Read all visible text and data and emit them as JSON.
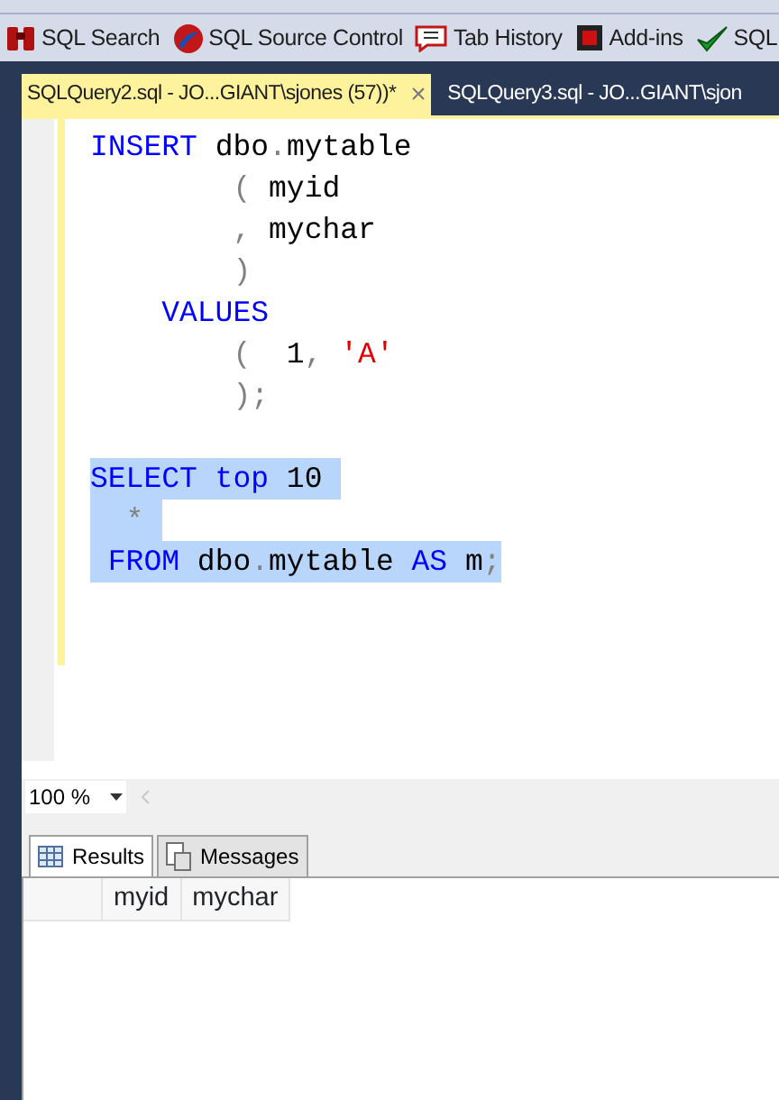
{
  "toolbar": [
    {
      "label": "SQL Search"
    },
    {
      "label": "SQL Source Control"
    },
    {
      "label": "Tab History"
    },
    {
      "label": "Add-ins"
    },
    {
      "label": "SQL"
    }
  ],
  "document_tabs": [
    {
      "label": "SQLQuery2.sql - JO...GIANT\\sjones (57))*",
      "selected": true,
      "close": "×"
    },
    {
      "label": "SQLQuery3.sql - JO...GIANT\\sjon",
      "selected": false
    }
  ],
  "editor": {
    "lines": [
      {
        "selected": false,
        "tokens": [
          {
            "kind": "keyword",
            "text": "INSERT"
          },
          {
            "kind": "plain",
            "text": " dbo"
          },
          {
            "kind": "punct",
            "text": "."
          },
          {
            "kind": "plain",
            "text": "mytable"
          }
        ]
      },
      {
        "selected": false,
        "tokens": [
          {
            "kind": "punct",
            "text": "        ("
          },
          {
            "kind": "plain",
            "text": " myid"
          }
        ]
      },
      {
        "selected": false,
        "tokens": [
          {
            "kind": "punct",
            "text": "        ,"
          },
          {
            "kind": "plain",
            "text": " mychar"
          }
        ]
      },
      {
        "selected": false,
        "tokens": [
          {
            "kind": "punct",
            "text": "        )"
          }
        ]
      },
      {
        "selected": false,
        "tokens": [
          {
            "kind": "keyword",
            "text": "    VALUES"
          }
        ]
      },
      {
        "selected": false,
        "tokens": [
          {
            "kind": "punct",
            "text": "        ("
          },
          {
            "kind": "plain",
            "text": "  1"
          },
          {
            "kind": "punct",
            "text": ","
          },
          {
            "kind": "string",
            "text": " 'A'"
          }
        ]
      },
      {
        "selected": false,
        "tokens": [
          {
            "kind": "punct",
            "text": "        );"
          }
        ]
      },
      {
        "selected": false
      },
      {
        "selected": true,
        "tokens": [
          {
            "kind": "keyword",
            "text": "SELECT top"
          },
          {
            "kind": "plain",
            "text": " 10 "
          }
        ]
      },
      {
        "selected": true,
        "tokens": [
          {
            "kind": "punct",
            "text": "  * "
          }
        ]
      },
      {
        "selected": true,
        "tokens": [
          {
            "kind": "keyword",
            "text": " FROM"
          },
          {
            "kind": "plain",
            "text": " dbo"
          },
          {
            "kind": "punct",
            "text": "."
          },
          {
            "kind": "plain",
            "text": "mytable "
          },
          {
            "kind": "keyword",
            "text": "AS"
          },
          {
            "kind": "plain",
            "text": " m"
          },
          {
            "kind": "punct",
            "text": ";"
          }
        ]
      }
    ]
  },
  "zoom": {
    "value": "100 %"
  },
  "result_tabs": [
    {
      "label": "Results",
      "selected": true
    },
    {
      "label": "Messages",
      "selected": false
    }
  ],
  "grid": {
    "columns": [
      "myid",
      "mychar"
    ]
  }
}
